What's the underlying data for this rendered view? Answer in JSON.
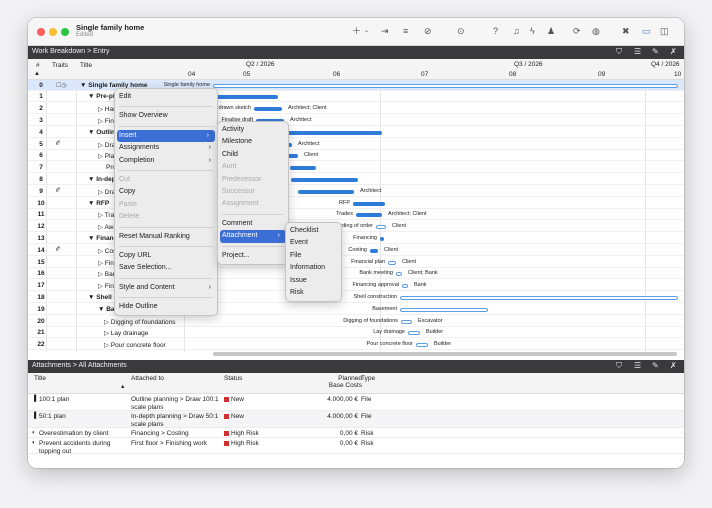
{
  "window": {
    "title": "Single family home",
    "subtitle": "Edited"
  },
  "toolbar": {
    "icons": [
      "plus-icon",
      "chevron-down-icon",
      "indent-icon",
      "outdent-icon",
      "link-icon",
      "chevron-down-icon",
      "more-icon",
      "chevron-down-icon",
      "question-icon",
      "bell-icon",
      "bolt-icon",
      "person-icon",
      "sync-icon",
      "globe-icon",
      "tools-icon",
      "split-view-icon",
      "sidebar-icon"
    ]
  },
  "top_bar": {
    "breadcrumb": "Work Breakdown > Entry"
  },
  "columns": {
    "num": "#",
    "traits": "Traits",
    "title": "Title"
  },
  "timeline": {
    "quarters": [
      "Q2 / 2026",
      "Q3 / 2026",
      "Q4 / 2026"
    ],
    "months": [
      "04",
      "05",
      "06",
      "07",
      "08",
      "09",
      "10"
    ]
  },
  "rows": [
    {
      "n": "0",
      "tr": "☐◷",
      "t": "▼ Single family home",
      "bold": true,
      "gl": "Single family home"
    },
    {
      "n": "1",
      "tr": "",
      "t": "▼ Pre-planning",
      "bold": true,
      "gl": "Pre-planning"
    },
    {
      "n": "2",
      "tr": "",
      "t": "▷ Hand-drawn sketch",
      "bold": false,
      "gl": "Hand-drawn sketch",
      "ar": "Architect; Client"
    },
    {
      "n": "3",
      "tr": "",
      "t": "▷ Finalise draft",
      "bold": false,
      "gl": "Finalise draft",
      "ar": "Architect"
    },
    {
      "n": "4",
      "tr": "",
      "t": "▼ Outline planning",
      "bold": true,
      "gl": ""
    },
    {
      "n": "5",
      "tr": "𝓞",
      "t": "▷ Draw 100:1 scale plans",
      "bold": false,
      "gl": "",
      "ar": "Architect"
    },
    {
      "n": "6",
      "tr": "",
      "t": "▷ Planning application",
      "bold": false,
      "gl": "",
      "ar": "Client"
    },
    {
      "n": "7",
      "tr": "",
      "t": "Project approval",
      "bold": false,
      "gl": ""
    },
    {
      "n": "8",
      "tr": "",
      "t": "▼ In-depth planning",
      "bold": true,
      "gl": ""
    },
    {
      "n": "9",
      "tr": "𝓞",
      "t": "▷ Draw 50:1 scale plans",
      "bold": false,
      "gl": "",
      "ar": "Architect"
    },
    {
      "n": "10",
      "tr": "",
      "t": "▼ RFP",
      "bold": true,
      "gl": "RFP"
    },
    {
      "n": "11",
      "tr": "",
      "t": "▷ Trades",
      "bold": false,
      "gl": "Trades",
      "ar": "Architect; Client"
    },
    {
      "n": "12",
      "tr": "",
      "t": "▷ Awarding of order",
      "bold": false,
      "gl": "Awarding of order",
      "ar": "Client"
    },
    {
      "n": "13",
      "tr": "",
      "t": "▼ Financing",
      "bold": true,
      "gl": "Financing"
    },
    {
      "n": "14",
      "tr": "𝓞",
      "t": "▷ Costing",
      "bold": false,
      "gl": "Costing",
      "ar": "Client"
    },
    {
      "n": "15",
      "tr": "",
      "t": "▷ Financial plan",
      "bold": false,
      "gl": "Financial plan",
      "ar": "Client"
    },
    {
      "n": "16",
      "tr": "",
      "t": "▷ Bank meeting",
      "bold": false,
      "gl": "Bank meeting",
      "ar": "Client; Bank"
    },
    {
      "n": "17",
      "tr": "",
      "t": "▷ Financing approval",
      "bold": false,
      "gl": "Financing approval",
      "ar": "Bank"
    },
    {
      "n": "18",
      "tr": "",
      "t": "▼ Shell construction",
      "bold": true,
      "gl": "Shell construction"
    },
    {
      "n": "19",
      "tr": "",
      "t": "▼ Basement",
      "bold": true,
      "gl": "Basement"
    },
    {
      "n": "20",
      "tr": "",
      "t": "▷ Digging of foundations",
      "bold": false,
      "gl": "Digging of foundations",
      "ar": "Excavator"
    },
    {
      "n": "21",
      "tr": "",
      "t": "▷ Lay drainage",
      "bold": false,
      "gl": "Lay drainage",
      "ar": "Builder"
    },
    {
      "n": "22",
      "tr": "",
      "t": "▷ Pour concrete floor",
      "bold": false,
      "gl": "Pour concrete floor",
      "ar": "Builder"
    }
  ],
  "context_menu": {
    "items": [
      {
        "label": "Edit",
        "type": "item"
      },
      {
        "type": "sep"
      },
      {
        "label": "Show Overview",
        "type": "item"
      },
      {
        "type": "sep"
      },
      {
        "label": "Insert",
        "type": "item",
        "sub": true,
        "hi": true
      },
      {
        "label": "Assignments",
        "type": "item",
        "sub": true
      },
      {
        "label": "Completion",
        "type": "item",
        "sub": true
      },
      {
        "type": "sep"
      },
      {
        "label": "Cut",
        "type": "item",
        "dis": true
      },
      {
        "label": "Copy",
        "type": "item"
      },
      {
        "label": "Paste",
        "type": "item",
        "dis": true
      },
      {
        "label": "Delete",
        "type": "item",
        "dis": true
      },
      {
        "type": "sep"
      },
      {
        "label": "Reset Manual Ranking",
        "type": "item"
      },
      {
        "type": "sep"
      },
      {
        "label": "Copy URL",
        "type": "item"
      },
      {
        "label": "Save Selection...",
        "type": "item"
      },
      {
        "type": "sep"
      },
      {
        "label": "Style and Content",
        "type": "item",
        "sub": true
      },
      {
        "type": "sep"
      },
      {
        "label": "Hide Outline",
        "type": "item"
      }
    ]
  },
  "insert_menu": {
    "items": [
      {
        "label": "Activity",
        "type": "item"
      },
      {
        "label": "Milestone",
        "type": "item"
      },
      {
        "label": "Child",
        "type": "item"
      },
      {
        "label": "Aunt",
        "type": "item",
        "dis": true
      },
      {
        "label": "Predecessor",
        "type": "item",
        "dis": true
      },
      {
        "label": "Successor",
        "type": "item",
        "dis": true
      },
      {
        "label": "Assignment",
        "type": "item",
        "dis": true
      },
      {
        "type": "sep"
      },
      {
        "label": "Comment",
        "type": "item"
      },
      {
        "label": "Attachment",
        "type": "item",
        "sub": true,
        "hi": true
      },
      {
        "type": "sep"
      },
      {
        "label": "Project...",
        "type": "item"
      }
    ]
  },
  "attachment_menu": {
    "items": [
      {
        "label": "Checklist",
        "type": "item"
      },
      {
        "label": "Event",
        "type": "item"
      },
      {
        "label": "File",
        "type": "item"
      },
      {
        "label": "Information",
        "type": "item"
      },
      {
        "label": "Issue",
        "type": "item"
      },
      {
        "label": "Risk",
        "type": "item"
      }
    ]
  },
  "attachments_bar": {
    "breadcrumb": "Attachments > All Attachments"
  },
  "attachments": {
    "headers": {
      "title": "Title",
      "attached": "Attached to",
      "status": "Status",
      "cost": "Planned Base Costs",
      "type": "Type"
    },
    "rows": [
      {
        "icon": "▐",
        "title": "100:1 plan",
        "attached": "Outline planning > Draw 100:1 scale plans",
        "status": "New",
        "cost": "4.000,00 €",
        "type": "File"
      },
      {
        "icon": "▐",
        "title": "50:1 plan",
        "attached": "In-depth planning > Draw 50:1 scale plans",
        "status": "New",
        "cost": "4.000,00 €",
        "type": "File"
      },
      {
        "icon": "◐",
        "title": "Overestimation by client",
        "attached": "Financing > Costing",
        "status": "High Risk",
        "cost": "0,00 €",
        "type": "Risk"
      },
      {
        "icon": "◐",
        "title": "Prevent accidents during topping out",
        "attached": "First floor > Finishing work",
        "status": "High Risk",
        "cost": "0,00 €",
        "type": "Risk"
      }
    ]
  },
  "colors": {
    "accent": "#3b6fd6",
    "bar": "#2f7bd8",
    "risk": "#d32f2f"
  }
}
